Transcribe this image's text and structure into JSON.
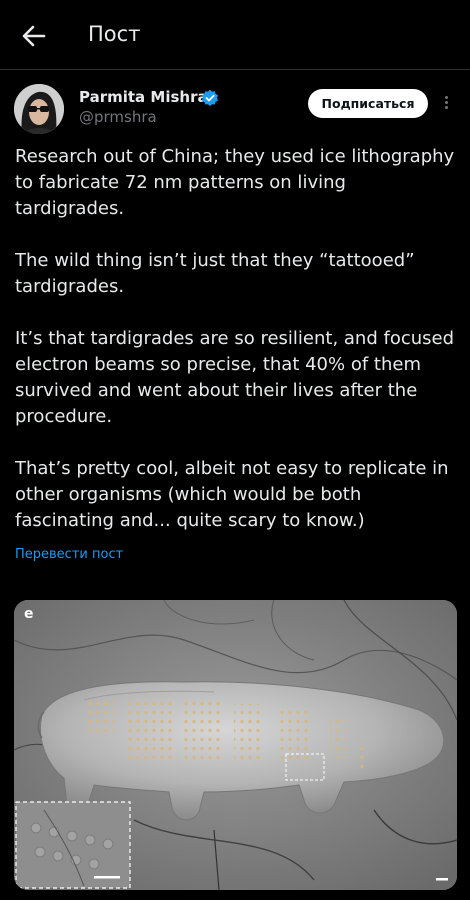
{
  "header": {
    "title": "Пост"
  },
  "author": {
    "name": "Parmita Mishra",
    "handle": "@prmshra",
    "verified": true
  },
  "follow": {
    "label": "Подписаться"
  },
  "tweet": {
    "paragraphs": [
      "Research out of China; they used ice lithography to fabricate 72 nm patterns on living tardigrades.",
      "The wild thing isn’t just that they “tattooed” tardigrades.",
      "It’s that tardigrades are so resilient, and focused electron beams so precise, that 40% of them survived and went about their lives after the procedure.",
      "That’s pretty cool, albeit not easy to replicate in other organisms (which would be both fascinating and... quite scary to know.)"
    ],
    "translate": "Перевести пост"
  },
  "media": {
    "panel_label": "e"
  },
  "colors": {
    "background": "#000000",
    "text": "#e7e9ea",
    "muted": "#71767b",
    "accent": "#1d9bf0"
  },
  "icons": {
    "back": "arrow-left-icon",
    "verified": "verified-badge-icon",
    "more": "more-vertical-icon"
  }
}
